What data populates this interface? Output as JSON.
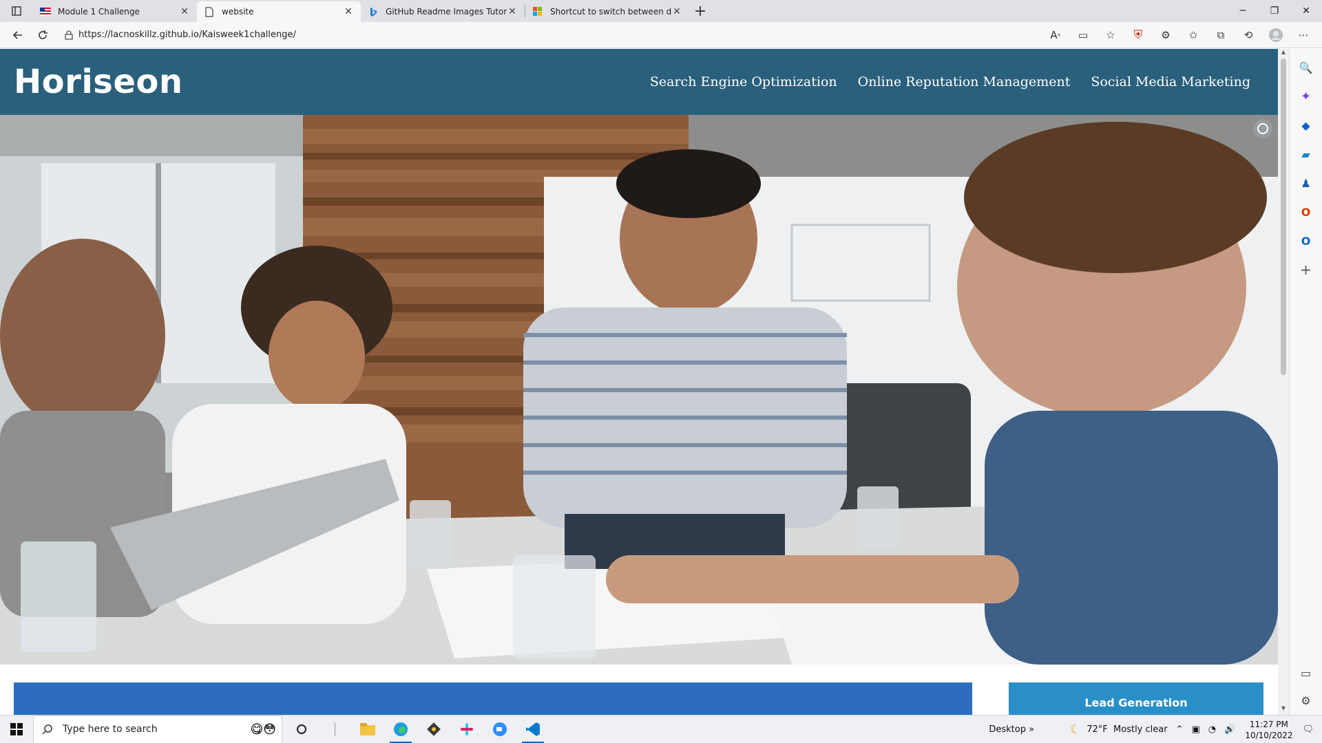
{
  "browser": {
    "tabs": [
      {
        "title": "Module 1 Challenge",
        "favicon": "usa-flag-icon",
        "active": false
      },
      {
        "title": "website",
        "favicon": "page-icon",
        "active": true
      },
      {
        "title": "GitHub Readme Images Tutorial",
        "favicon": "bing-icon",
        "active": false
      },
      {
        "title": "Shortcut to switch between disp",
        "favicon": "microsoft-icon",
        "active": false
      }
    ],
    "url": "https://lacnoskillz.github.io/Kaisweek1challenge/"
  },
  "site": {
    "logo": "Horiseon",
    "nav": [
      "Search Engine Optimization",
      "Online Reputation Management",
      "Social Media Marketing"
    ],
    "side_heading": "Lead Generation",
    "header_color": "#2a607c",
    "main_box_color": "#2c6ebd",
    "side_box_color": "#2a8fc7"
  },
  "taskbar": {
    "search_placeholder": "Type here to search",
    "desktop_label": "Desktop",
    "weather_temp": "72°F",
    "weather_desc": "Mostly clear",
    "time": "11:27 PM",
    "date": "10/10/2022"
  }
}
